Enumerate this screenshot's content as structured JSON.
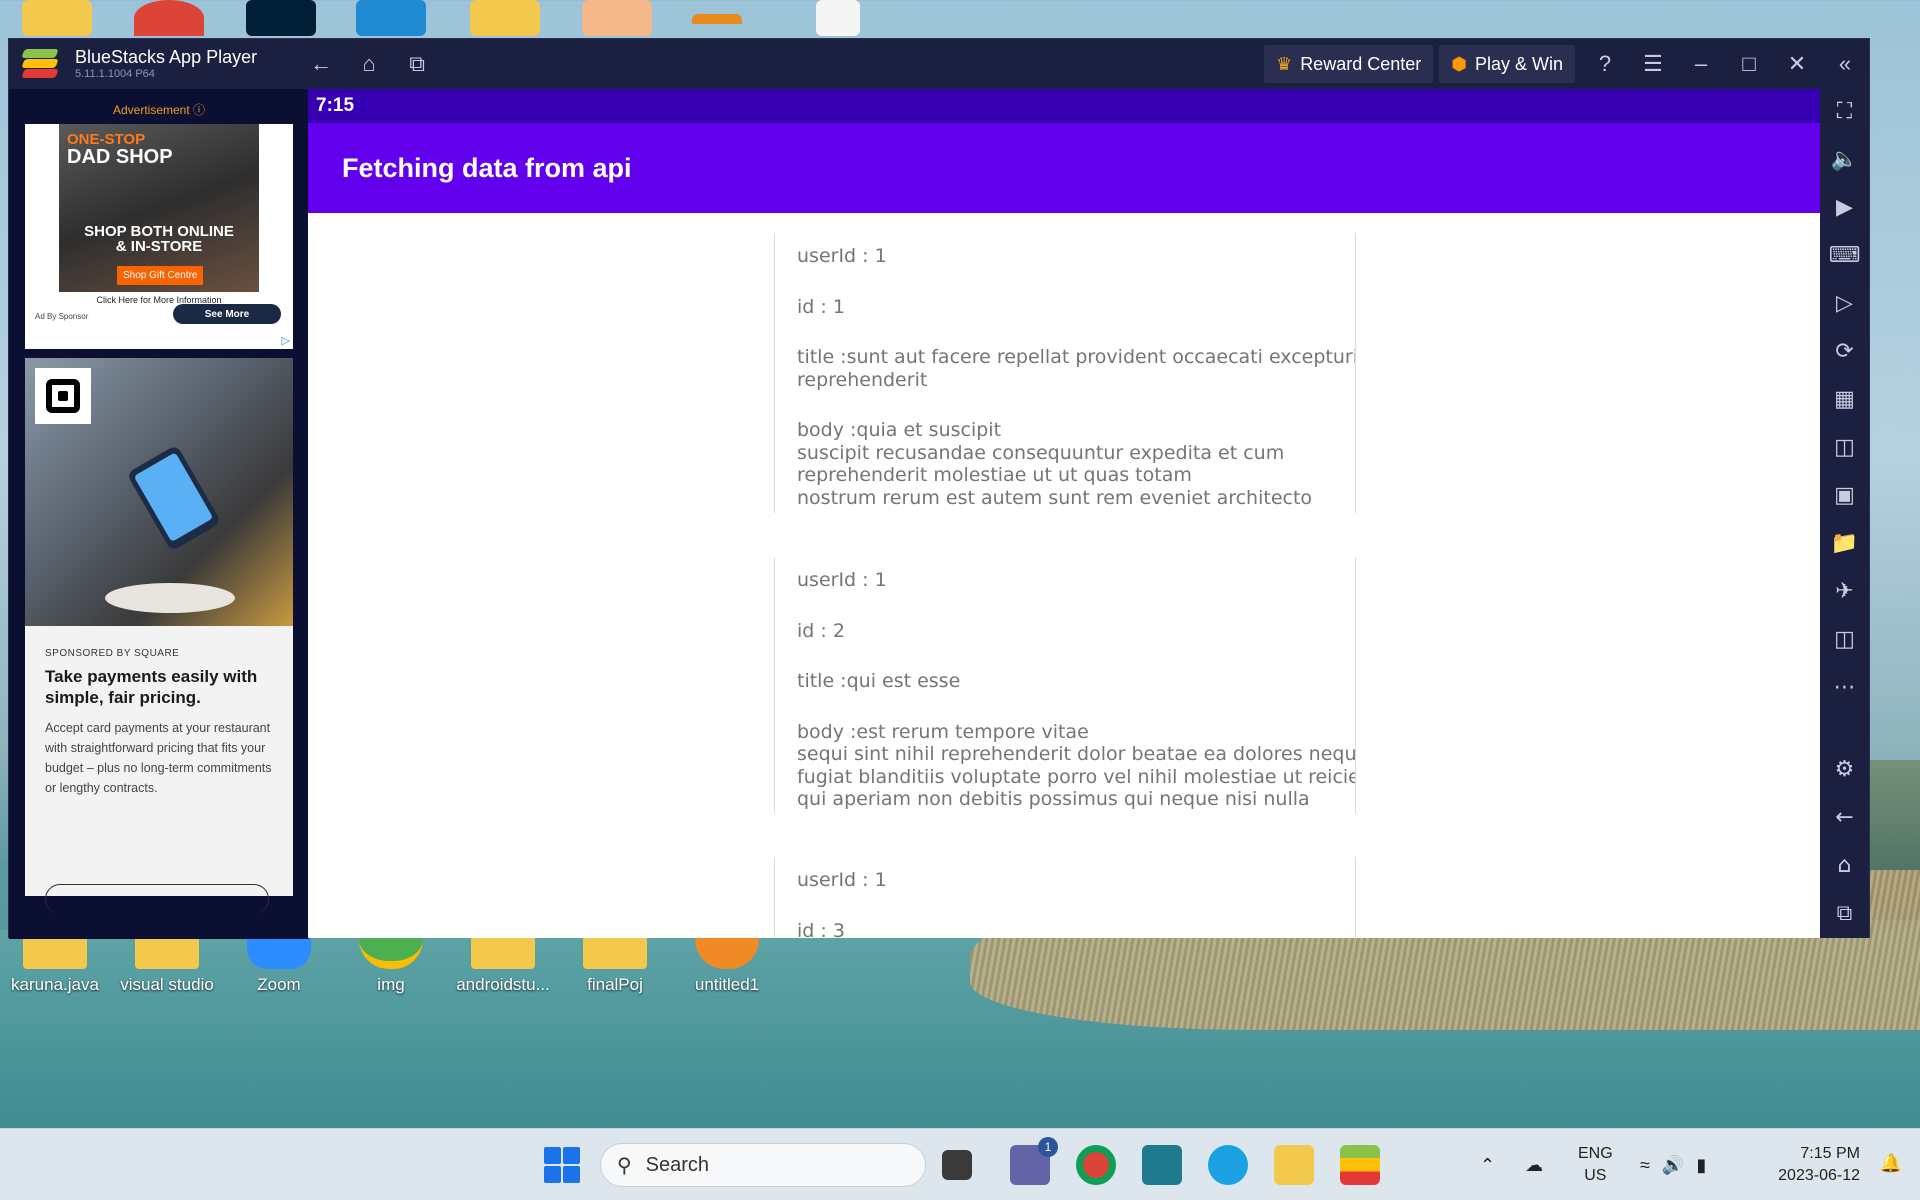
{
  "desktop": {
    "icons": [
      {
        "label": "karuna.java"
      },
      {
        "label": "visual studio"
      },
      {
        "label": "Zoom"
      },
      {
        "label": "img"
      },
      {
        "label": "androidstu..."
      },
      {
        "label": "finalPoj"
      },
      {
        "label": "untitled1"
      }
    ]
  },
  "window": {
    "title": "BlueStacks App Player",
    "version": "5.11.1.1004  P64",
    "reward_center": "Reward Center",
    "play_win": "Play & Win"
  },
  "ad_panel": {
    "label": "Advertisement ⓘ",
    "ad1": {
      "headline_top": "ONE-STOP",
      "headline_main": "DAD SHOP",
      "shop_line1": "SHOP BOTH ONLINE",
      "shop_line2": "& IN-STORE",
      "gift_button": "Shop Gift Centre",
      "click_text": "Click Here for More Information",
      "sponsor": "Ad By Sponsor",
      "see_more": "See More"
    },
    "ad2": {
      "sponsored": "SPONSORED BY SQUARE",
      "headline": "Take payments easily with simple, fair pricing.",
      "description": "Accept card payments at your restaurant with straightforward pricing that fits your budget – plus no long-term commitments or lengthy contracts."
    }
  },
  "android": {
    "time": "7:15",
    "app_title": "Fetching data from api",
    "posts": [
      {
        "userId": "userId : 1",
        "id": "id : 1",
        "title": "title :sunt aut facere repellat provident occaecati excepturi optio\nreprehenderit",
        "body": "body :quia et suscipit\nsuscipit recusandae consequuntur expedita et cum\nreprehenderit molestiae ut ut quas totam\nnostrum rerum est autem sunt rem eveniet architecto"
      },
      {
        "userId": "userId : 1",
        "id": "id : 2",
        "title": "title :qui est esse",
        "body": "body :est rerum tempore vitae\nsequi sint nihil reprehenderit dolor beatae ea dolores neque\nfugiat blanditiis voluptate porro vel nihil molestiae ut reiciendis\nqui aperiam non debitis possimus qui neque nisi nulla"
      },
      {
        "userId": "userId : 1",
        "id": "id : 3"
      }
    ]
  },
  "taskbar": {
    "search_placeholder": "Search",
    "chat_badge": "1",
    "lang_line1": "ENG",
    "lang_line2": "US",
    "time": "7:15 PM",
    "date": "2023-06-12"
  },
  "colors": {
    "status_bar": "#3700b3",
    "app_bar": "#6200ee",
    "window_chrome": "#1c2040"
  }
}
